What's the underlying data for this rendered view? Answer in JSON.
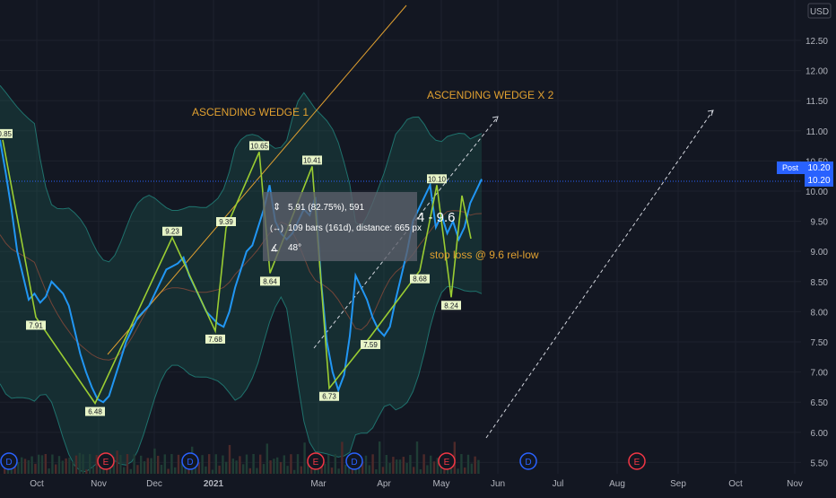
{
  "currency": "USD",
  "post_badge": {
    "label": "Post",
    "value": "10.20"
  },
  "price_ticks": [
    "12.50",
    "12.00",
    "11.50",
    "11.00",
    "10.50",
    "10.00",
    "9.50",
    "9.00",
    "8.50",
    "8.00",
    "7.50",
    "7.00",
    "6.50",
    "6.00",
    "5.50"
  ],
  "time_ticks": [
    "Oct",
    "Nov",
    "Dec",
    "2021",
    "Mar",
    "Apr",
    "May",
    "Jun",
    "Jul",
    "Aug",
    "Sep",
    "Oct",
    "Nov"
  ],
  "annotations": {
    "wedge1": "ASCENDING WEDGE 1",
    "wedge2": "ASCENDING WEDGE X 2",
    "stoploss": "stop loss @ 9.6 rel-low",
    "price_range": "4 - 9.6"
  },
  "measure_tooltip": {
    "line1": "5.91 (82.75%), 591",
    "line2": "109 bars (161d), distance: 665 px",
    "line3": "48°"
  },
  "event_markers": [
    "D",
    "E",
    "D",
    "E",
    "D",
    "E",
    "D",
    "E"
  ],
  "colors": {
    "background": "#131722",
    "price_line": "#2196f3",
    "wave_line": "#9acd32",
    "band_fill": "#1f6b5e",
    "band_line": "#26a69a",
    "orange": "#e0a030",
    "post_badge": "#2962ff"
  },
  "chart_data": {
    "type": "line",
    "title": "",
    "ylabel": "USD",
    "ylim": [
      5.4,
      12.8
    ],
    "grid": true,
    "series": [
      {
        "values": [
          10.85,
          10.3,
          9.7,
          9.0,
          8.6,
          8.2,
          8.3,
          8.15,
          8.25,
          8.5,
          8.4,
          8.3,
          8.1,
          7.7,
          7.3,
          7.0,
          6.75,
          6.55,
          6.5,
          6.6,
          6.9,
          7.2,
          7.5,
          7.7,
          7.9,
          8.0,
          8.1,
          8.3,
          8.5,
          8.7,
          8.75,
          8.8,
          8.9,
          8.6,
          8.4,
          8.2,
          8.0,
          7.9,
          7.8,
          7.75,
          8.0,
          8.4,
          8.7,
          9.0,
          9.1,
          9.4,
          9.7,
          10.1,
          9.5,
          9.3,
          9.2,
          9.3,
          9.5,
          9.7,
          9.6,
          9.9,
          8.5,
          7.5,
          7.0,
          6.7,
          6.95,
          7.6,
          8.6,
          8.4,
          8.2,
          7.9,
          7.7,
          7.6,
          7.75,
          8.2,
          8.6,
          9.0,
          9.5,
          9.7,
          9.9,
          10.1,
          9.4,
          9.6,
          9.3,
          9.5,
          9.2,
          9.4,
          9.8,
          10.0,
          10.2
        ]
      },
      {
        "name": "",
        "x_label_points": [
          {
            "label": "10.85",
            "value": 10.85
          },
          {
            "label": "7.91",
            "value": 7.91
          },
          {
            "label": "6.48",
            "value": 6.48
          },
          {
            "label": "9.23",
            "value": 9.23
          },
          {
            "label": "7.68",
            "value": 7.68
          },
          {
            "label": "9.39",
            "value": 9.39
          },
          {
            "label": "10.65",
            "value": 10.65
          },
          {
            "label": "8.64",
            "value": 8.64
          },
          {
            "label": "10.41",
            "value": 10.41
          },
          {
            "label": "6.73",
            "value": 6.73
          },
          {
            "label": "7.59",
            "value": 7.59
          },
          {
            "label": "8.68",
            "value": 8.68
          },
          {
            "label": "10.10",
            "value": 10.1
          },
          {
            "label": "8.24",
            "value": 8.24
          }
        ]
      }
    ]
  }
}
